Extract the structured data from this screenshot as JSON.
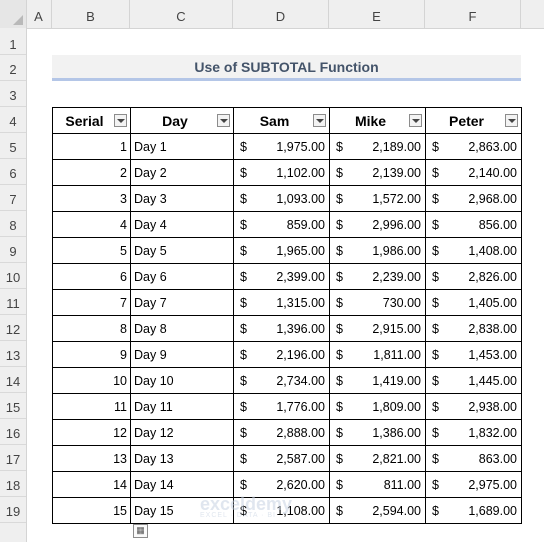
{
  "columns": [
    "A",
    "B",
    "C",
    "D",
    "E",
    "F"
  ],
  "rows": [
    "1",
    "2",
    "3",
    "4",
    "5",
    "6",
    "7",
    "8",
    "9",
    "10",
    "11",
    "12",
    "13",
    "14",
    "15",
    "16",
    "17",
    "18",
    "19"
  ],
  "title": "Use of SUBTOTAL Function",
  "table": {
    "headers": [
      "Serial",
      "Day",
      "Sam",
      "Mike",
      "Peter"
    ],
    "currency_symbol": "$",
    "rows": [
      {
        "serial": "1",
        "day": "Day 1",
        "sam": "1,975.00",
        "mike": "2,189.00",
        "peter": "2,863.00"
      },
      {
        "serial": "2",
        "day": "Day 2",
        "sam": "1,102.00",
        "mike": "2,139.00",
        "peter": "2,140.00"
      },
      {
        "serial": "3",
        "day": "Day 3",
        "sam": "1,093.00",
        "mike": "1,572.00",
        "peter": "2,968.00"
      },
      {
        "serial": "4",
        "day": "Day 4",
        "sam": "859.00",
        "mike": "2,996.00",
        "peter": "856.00"
      },
      {
        "serial": "5",
        "day": "Day 5",
        "sam": "1,965.00",
        "mike": "1,986.00",
        "peter": "1,408.00"
      },
      {
        "serial": "6",
        "day": "Day 6",
        "sam": "2,399.00",
        "mike": "2,239.00",
        "peter": "2,826.00"
      },
      {
        "serial": "7",
        "day": "Day 7",
        "sam": "1,315.00",
        "mike": "730.00",
        "peter": "1,405.00"
      },
      {
        "serial": "8",
        "day": "Day 8",
        "sam": "1,396.00",
        "mike": "2,915.00",
        "peter": "2,838.00"
      },
      {
        "serial": "9",
        "day": "Day 9",
        "sam": "2,196.00",
        "mike": "1,811.00",
        "peter": "1,453.00"
      },
      {
        "serial": "10",
        "day": "Day 10",
        "sam": "2,734.00",
        "mike": "1,419.00",
        "peter": "1,445.00"
      },
      {
        "serial": "11",
        "day": "Day 11",
        "sam": "1,776.00",
        "mike": "1,809.00",
        "peter": "2,938.00"
      },
      {
        "serial": "12",
        "day": "Day 12",
        "sam": "2,888.00",
        "mike": "1,386.00",
        "peter": "1,832.00"
      },
      {
        "serial": "13",
        "day": "Day 13",
        "sam": "2,587.00",
        "mike": "2,821.00",
        "peter": "863.00"
      },
      {
        "serial": "14",
        "day": "Day 14",
        "sam": "2,620.00",
        "mike": "811.00",
        "peter": "2,975.00"
      },
      {
        "serial": "15",
        "day": "Day 15",
        "sam": "1,108.00",
        "mike": "2,594.00",
        "peter": "1,689.00"
      }
    ]
  },
  "watermark": {
    "name": "exceldemy",
    "tagline": "EXCEL · DATA · BI"
  }
}
